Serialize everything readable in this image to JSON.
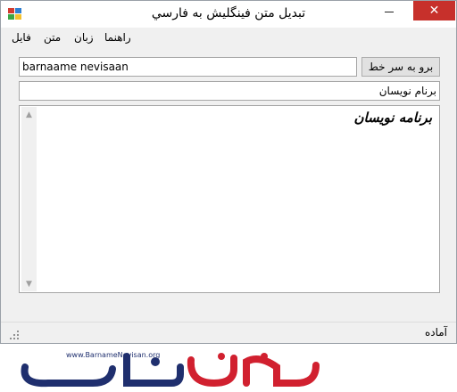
{
  "window": {
    "title": "تبديل متن فينگليش به فارسي"
  },
  "titlebar_buttons": {
    "close": "✕"
  },
  "menu": {
    "items": [
      "راهنما",
      "زبان",
      "متن",
      "فايل"
    ]
  },
  "input": {
    "value": "barnaame nevisaan"
  },
  "convert_button": {
    "label": "برو به سر خط"
  },
  "output_field": {
    "value": "برنام نویسان"
  },
  "textarea": {
    "text": "برنامه نویسان"
  },
  "status": {
    "text": "آماده"
  },
  "logo": {
    "site": "www.BarnameNevisan.org",
    "brand": "برنامه نویسان"
  },
  "colors": {
    "close_button": "#c7302b",
    "logo_blue": "#1f2f6e",
    "logo_red": "#d1202f"
  },
  "icons": [
    "app-icon",
    "minimize-icon",
    "maximize-icon",
    "close-icon",
    "scroll-up-arrow-icon",
    "scroll-down-arrow-icon",
    "size-grip-icon"
  ]
}
